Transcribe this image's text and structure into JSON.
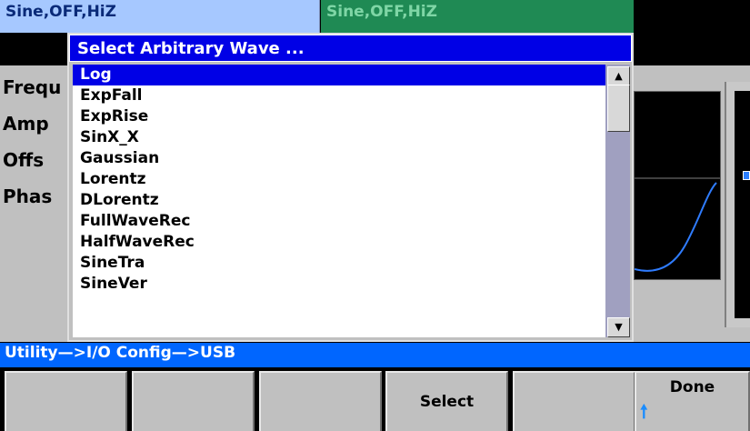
{
  "status_tabs": {
    "ch1": "Sine,OFF,HiZ",
    "ch2": "Sine,OFF,HiZ"
  },
  "params": {
    "frequency": "Frequ",
    "amplitude": "Amp",
    "offset": "Offs",
    "phase": "Phas"
  },
  "dialog": {
    "title": "Select Arbitrary Wave ...",
    "items": [
      {
        "label": "Log",
        "selected": true
      },
      {
        "label": "ExpFall"
      },
      {
        "label": "ExpRise"
      },
      {
        "label": "SinX_X"
      },
      {
        "label": "Gaussian"
      },
      {
        "label": "Lorentz"
      },
      {
        "label": "DLorentz"
      },
      {
        "label": "FullWaveRec"
      },
      {
        "label": "HalfWaveRec"
      },
      {
        "label": "SineTra"
      },
      {
        "label": "SineVer"
      }
    ],
    "scroll_up_icon": "up-arrow-icon",
    "scroll_down_icon": "down-arrow-icon"
  },
  "path_bar": "Utility—>I/O Config—>USB",
  "softkeys": {
    "k1": "",
    "k2": "",
    "k3": "",
    "k4": "Select",
    "k5": "",
    "k6": "Done",
    "done_icon": "up-arrow-icon"
  },
  "colors": {
    "accent_blue": "#0000e6",
    "path_bar_blue": "#0066ff",
    "tab_ch1": "#a6c8ff",
    "tab_ch2": "#1f8a54",
    "waveform": "#2f7cff"
  }
}
